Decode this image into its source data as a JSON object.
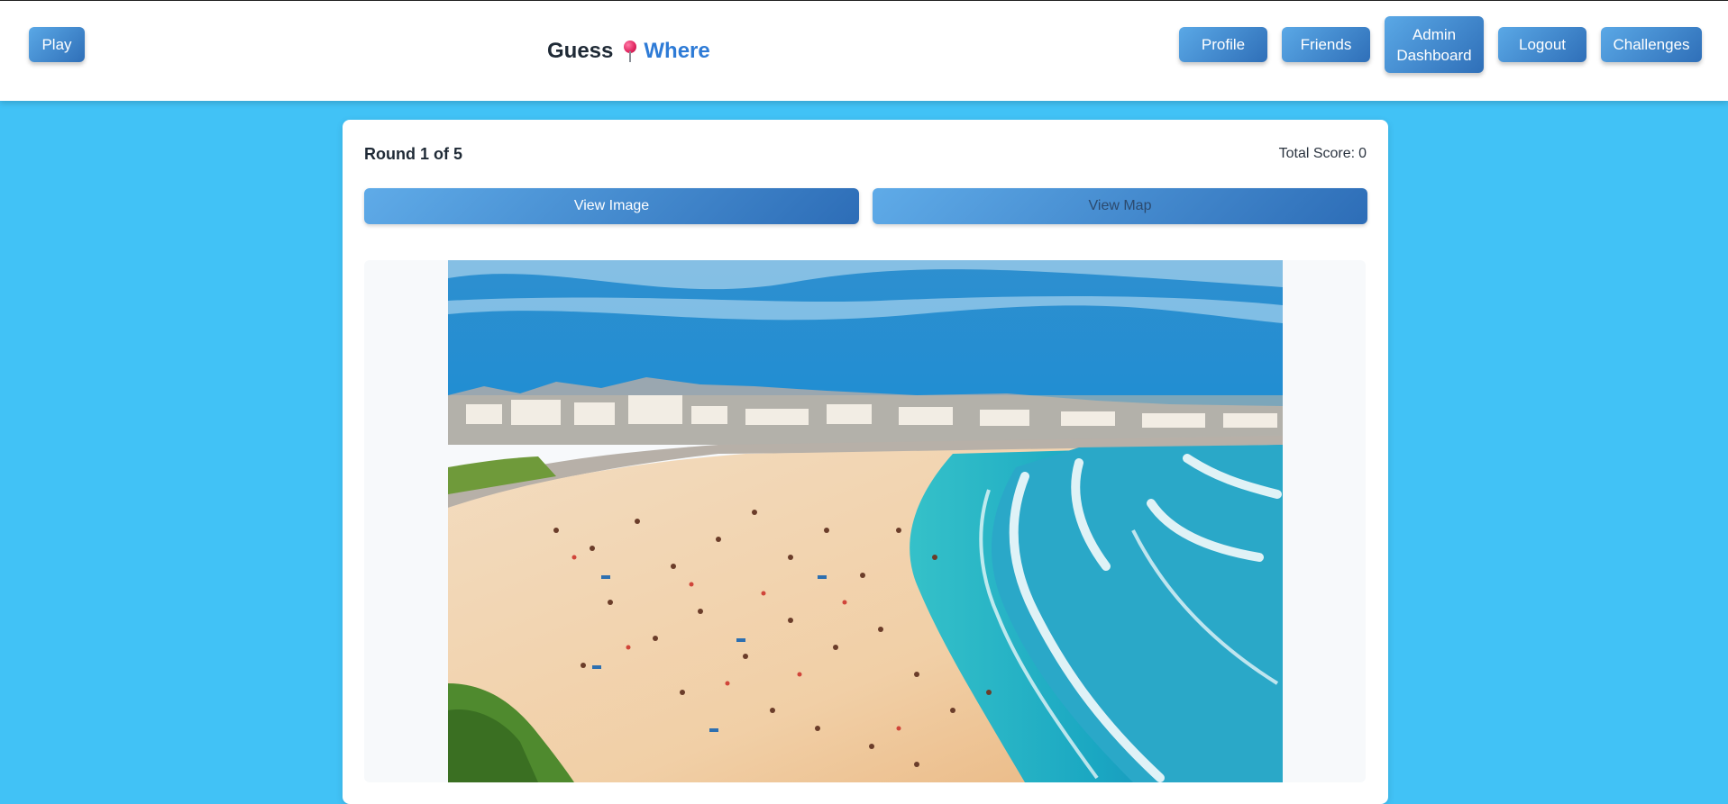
{
  "nav": {
    "play_label": "Play",
    "brand_guess": "Guess",
    "brand_where": "Where",
    "profile_label": "Profile",
    "friends_label": "Friends",
    "admin_label_line1": "Admin",
    "admin_label_line2": "Dashboard",
    "logout_label": "Logout",
    "challenges_label": "Challenges"
  },
  "game": {
    "round_label": "Round 1 of 5",
    "score_label": "Total Score:",
    "score_value": "0",
    "tabs": [
      {
        "label": "View Image",
        "active": true
      },
      {
        "label": "View Map",
        "active": false
      }
    ],
    "image_subject": "aerial view of a crowded sandy beach with turquoise surf and a coastal town"
  },
  "colors": {
    "page_background": "#41c2f6",
    "button_gradient_start": "#5aa8e6",
    "button_gradient_end": "#2f6fb8",
    "brand_accent": "#2e7bd6"
  },
  "icons": {
    "brand_pin": "pin-icon"
  }
}
